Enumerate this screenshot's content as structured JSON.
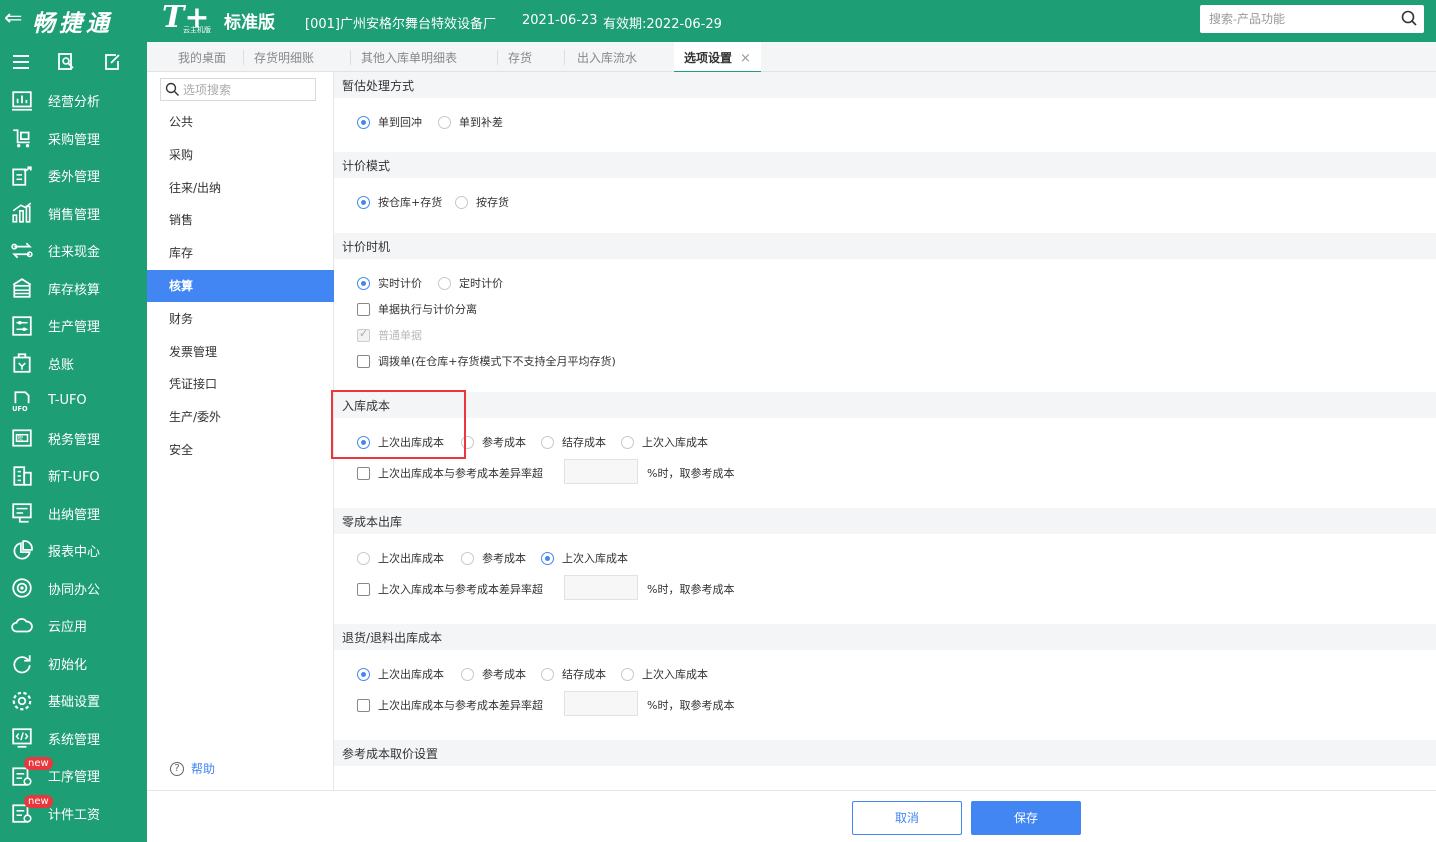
{
  "header": {
    "back_glyph": "⇐",
    "brand": "畅捷通",
    "logo_text": "T+",
    "logo_sub": "云主机版",
    "edition": "标准版",
    "company": "[001]广州安格尔舞台特效设备厂",
    "date": "2021-06-23",
    "expiry": "有效期:2022-06-29",
    "search_placeholder": "搜索-产品功能"
  },
  "sidebar": {
    "tools": [
      "menu-icon",
      "search-doc-icon",
      "edit-doc-icon"
    ],
    "items": [
      {
        "label": "经营分析",
        "icon": "chart-icon"
      },
      {
        "label": "采购管理",
        "icon": "cart-icon"
      },
      {
        "label": "委外管理",
        "icon": "export-icon"
      },
      {
        "label": "销售管理",
        "icon": "bar-chart-icon"
      },
      {
        "label": "往来现金",
        "icon": "transfer-icon"
      },
      {
        "label": "库存核算",
        "icon": "warehouse-icon"
      },
      {
        "label": "生产管理",
        "icon": "production-icon"
      },
      {
        "label": "总账",
        "icon": "ledger-icon"
      },
      {
        "label": "T-UFO",
        "icon": "ufo-icon"
      },
      {
        "label": "税务管理",
        "icon": "tax-icon"
      },
      {
        "label": "新T-UFO",
        "icon": "building-icon"
      },
      {
        "label": "出纳管理",
        "icon": "cashier-icon"
      },
      {
        "label": "报表中心",
        "icon": "pie-chart-icon"
      },
      {
        "label": "协同办公",
        "icon": "collab-icon"
      },
      {
        "label": "云应用",
        "icon": "cloud-icon"
      },
      {
        "label": "初始化",
        "icon": "refresh-icon"
      },
      {
        "label": "基础设置",
        "icon": "gear-icon"
      },
      {
        "label": "系统管理",
        "icon": "code-icon"
      },
      {
        "label": "工序管理",
        "icon": "process-icon",
        "badge": "new"
      },
      {
        "label": "计件工资",
        "icon": "wage-icon",
        "badge": "new"
      }
    ]
  },
  "tabs": [
    {
      "label": "我的桌面"
    },
    {
      "label": "存货明细账"
    },
    {
      "label": "其他入库单明细表"
    },
    {
      "label": "存货"
    },
    {
      "label": "出入库流水"
    },
    {
      "label": "选项设置",
      "active": true,
      "close": "×"
    }
  ],
  "left_panel": {
    "search_placeholder": "选项搜索",
    "items": [
      "公共",
      "采购",
      "往来/出纳",
      "销售",
      "库存",
      "核算",
      "财务",
      "发票管理",
      "凭证接口",
      "生产/委外",
      "安全"
    ],
    "active_index": 5,
    "help": "帮助"
  },
  "sections": {
    "estimate": {
      "title": "暂估处理方式",
      "options": [
        {
          "label": "单到回冲",
          "checked": true
        },
        {
          "label": "单到补差",
          "checked": false
        }
      ]
    },
    "pricing_mode": {
      "title": "计价模式",
      "options": [
        {
          "label": "按仓库+存货",
          "checked": true
        },
        {
          "label": "按存货",
          "checked": false
        }
      ]
    },
    "pricing_time": {
      "title": "计价时机",
      "options": [
        {
          "label": "实时计价",
          "checked": true
        },
        {
          "label": "定时计价",
          "checked": false
        }
      ],
      "checkboxes": [
        {
          "label": "单据执行与计价分离",
          "checked": false,
          "disabled": false
        },
        {
          "label": "普通单据",
          "checked": true,
          "disabled": true
        },
        {
          "label": "调拨单(在仓库+存货模式下不支持全月平均存货)",
          "checked": false,
          "disabled": false
        }
      ]
    },
    "inbound_cost": {
      "title": "入库成本",
      "options": [
        {
          "label": "上次出库成本",
          "checked": true
        },
        {
          "label": "参考成本",
          "checked": false
        },
        {
          "label": "结存成本",
          "checked": false
        },
        {
          "label": "上次入库成本",
          "checked": false
        }
      ],
      "check_label": "上次出库成本与参考成本差异率超",
      "suffix": "%时，取参考成本"
    },
    "zero_cost": {
      "title": "零成本出库",
      "options": [
        {
          "label": "上次出库成本",
          "checked": false
        },
        {
          "label": "参考成本",
          "checked": false
        },
        {
          "label": "上次入库成本",
          "checked": true
        }
      ],
      "check_label": "上次入库成本与参考成本差异率超",
      "suffix": "%时，取参考成本"
    },
    "return_cost": {
      "title": "退货/退料出库成本",
      "options": [
        {
          "label": "上次出库成本",
          "checked": true
        },
        {
          "label": "参考成本",
          "checked": false
        },
        {
          "label": "结存成本",
          "checked": false
        },
        {
          "label": "上次入库成本",
          "checked": false
        }
      ],
      "check_label": "上次出库成本与参考成本差异率超",
      "suffix": "%时，取参考成本"
    },
    "ref_cost": {
      "title": "参考成本取价设置"
    }
  },
  "footer": {
    "cancel": "取消",
    "save": "保存"
  },
  "colors": {
    "brand_green": "#1e9e74",
    "accent_blue": "#4286f4",
    "highlight_red": "#e8383d"
  }
}
